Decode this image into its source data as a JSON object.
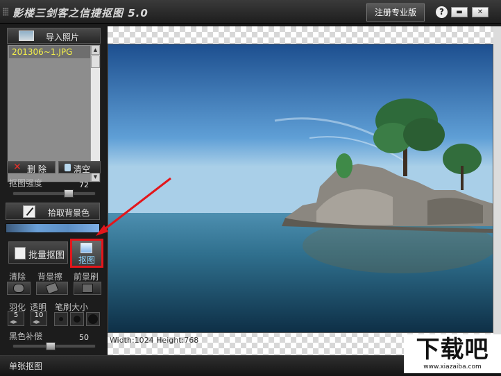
{
  "window": {
    "title": "影楼三剑客之信捷抠图 5.0",
    "register_label": "注册专业版",
    "help_label": "?",
    "minimize_label": "▬",
    "close_label": "✕"
  },
  "left_panel": {
    "import_label": "导入照片",
    "files": [
      "201306~1.JPG"
    ],
    "delete_label": "删 除",
    "clear_label": "清空",
    "strength_label": "抠图强度",
    "strength_value": "72",
    "pick_bg_label": "拾取背景色",
    "batch_label": "批量抠图",
    "cut_label": "抠图",
    "tools": {
      "clear": "清除",
      "bg_eraser": "背景擦",
      "fg_brush": "前景刷"
    },
    "feather_label": "羽化",
    "transparency_label": "透明",
    "brush_size_label": "笔刷大小",
    "feather_value": "5",
    "transparency_value": "10",
    "black_comp_label": "黑色补偿",
    "black_comp_value": "50"
  },
  "canvas": {
    "image_info": "Width:1024  Height:768"
  },
  "status": {
    "mode": "单张抠图"
  },
  "watermark": {
    "logo": "下载吧",
    "url": "www.xiazaiba.com"
  },
  "colors": {
    "highlight": "#e3161b",
    "list_item_text": "#f4f04a"
  }
}
